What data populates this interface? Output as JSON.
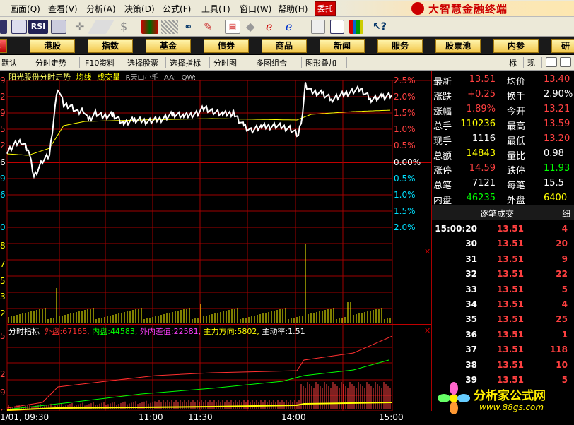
{
  "menubar": {
    "items": [
      {
        "label": "画面(",
        "key": "Q",
        "tail": ")"
      },
      {
        "label": "查看(",
        "key": "V",
        "tail": ")"
      },
      {
        "label": "分析(",
        "key": "A",
        "tail": ")"
      },
      {
        "label": "决策(",
        "key": "D",
        "tail": ")"
      },
      {
        "label": "公式(",
        "key": "F",
        "tail": ")"
      },
      {
        "label": "工具(",
        "key": "T",
        "tail": ")"
      },
      {
        "label": "窗口(",
        "key": "W",
        "tail": ")"
      },
      {
        "label": "帮助(",
        "key": "H",
        "tail": ")"
      }
    ],
    "weituo": "委托",
    "brand": "大智慧金融终端"
  },
  "toolbar": {
    "rsi": "RSI"
  },
  "navbar": {
    "items": [
      "票",
      "港股",
      "指数",
      "基金",
      "债券",
      "商品",
      "新闻",
      "服务",
      "股票池",
      "内参",
      "研"
    ]
  },
  "tabbar": {
    "items": [
      "默认",
      "分时走势",
      "F10资料",
      "选择股票",
      "选择指标",
      "分时图",
      "多图组合",
      "图形叠加"
    ],
    "right": [
      "标",
      "现"
    ]
  },
  "chart": {
    "stock_name": "阳光股份",
    "view": "分时走势",
    "avg_label": "均线",
    "vol_label": "成交量",
    "extra1": "R天山小毛",
    "extra2": "AA:",
    "extra3": "QW:",
    "left_ticks": [
      "9",
      "2",
      "9",
      "5",
      "2",
      "6",
      "9",
      "6",
      "0",
      "8",
      "7",
      "5",
      "3",
      "2"
    ],
    "pct_up": [
      "2.5%",
      "2.0%",
      "1.5%",
      "1.0%",
      "0.5%"
    ],
    "pct_zero": "0.00%",
    "pct_down": [
      "0.5%",
      "1.0%",
      "1.5%",
      "2.0%"
    ],
    "ind_title": "分时指标",
    "ind_outer_label": "外盘:",
    "ind_outer_val": "67165,",
    "ind_inner_label": "内盘:",
    "ind_inner_val": "44583,",
    "ind_diff_label": "外内差值:",
    "ind_diff_val": "22581,",
    "ind_main_label": "主力方向:",
    "ind_main_val": "5802,",
    "ind_active_label": "主动率:",
    "ind_active_val": "1.51",
    "ind_left_ticks": [
      "5",
      "2",
      "9",
      "6"
    ],
    "time_labels": [
      "1/01, 09:30",
      "11:00",
      "11:30",
      "14:00",
      "15:00"
    ],
    "colors": {
      "price": "#ffffff",
      "avg": "#ffff00",
      "outer": "#ff3030",
      "inner": "#00ff00",
      "vol": "#ffff00",
      "grid": "#a00000"
    }
  },
  "quote": {
    "rows": [
      {
        "l1": "最新",
        "v1": "13.51",
        "l2": "均价",
        "v2": "13.40"
      },
      {
        "l1": "涨跌",
        "v1": "+0.25",
        "l2": "换手",
        "v2": "2.90%"
      },
      {
        "l1": "涨幅",
        "v1": "1.89%",
        "l2": "今开",
        "v2": "13.21"
      },
      {
        "l1": "总手",
        "v1": "110236",
        "l2": "最高",
        "v2": "13.59"
      },
      {
        "l1": "现手",
        "v1": "1116",
        "l2": "最低",
        "v2": "13.20"
      },
      {
        "l1": "总额",
        "v1": "14843",
        "l2": "量比",
        "v2": "0.98"
      },
      {
        "l1": "涨停",
        "v1": "14.59",
        "l2": "跌停",
        "v2": "11.93"
      },
      {
        "l1": "总笔",
        "v1": "7121",
        "l2": "每笔",
        "v2": "15.5"
      },
      {
        "l1": "内盘",
        "v1": "46235",
        "l2": "外盘",
        "v2": "6400"
      }
    ],
    "header": "逐笔成交",
    "header_right": "细",
    "trades": [
      {
        "t": "15:00:20",
        "p": "13.51",
        "v": "4"
      },
      {
        "t": "30",
        "p": "13.51",
        "v": "20"
      },
      {
        "t": "31",
        "p": "13.51",
        "v": "9"
      },
      {
        "t": "32",
        "p": "13.51",
        "v": "22"
      },
      {
        "t": "33",
        "p": "13.51",
        "v": "5"
      },
      {
        "t": "34",
        "p": "13.51",
        "v": "4"
      },
      {
        "t": "35",
        "p": "13.51",
        "v": "25"
      },
      {
        "t": "36",
        "p": "13.51",
        "v": "1"
      },
      {
        "t": "37",
        "p": "13.51",
        "v": "118"
      },
      {
        "t": "38",
        "p": "13.51",
        "v": "10"
      },
      {
        "t": "39",
        "p": "13.51",
        "v": "5"
      }
    ]
  },
  "watermark": {
    "title": "分析家公式网",
    "url": "www.88gs.com"
  }
}
